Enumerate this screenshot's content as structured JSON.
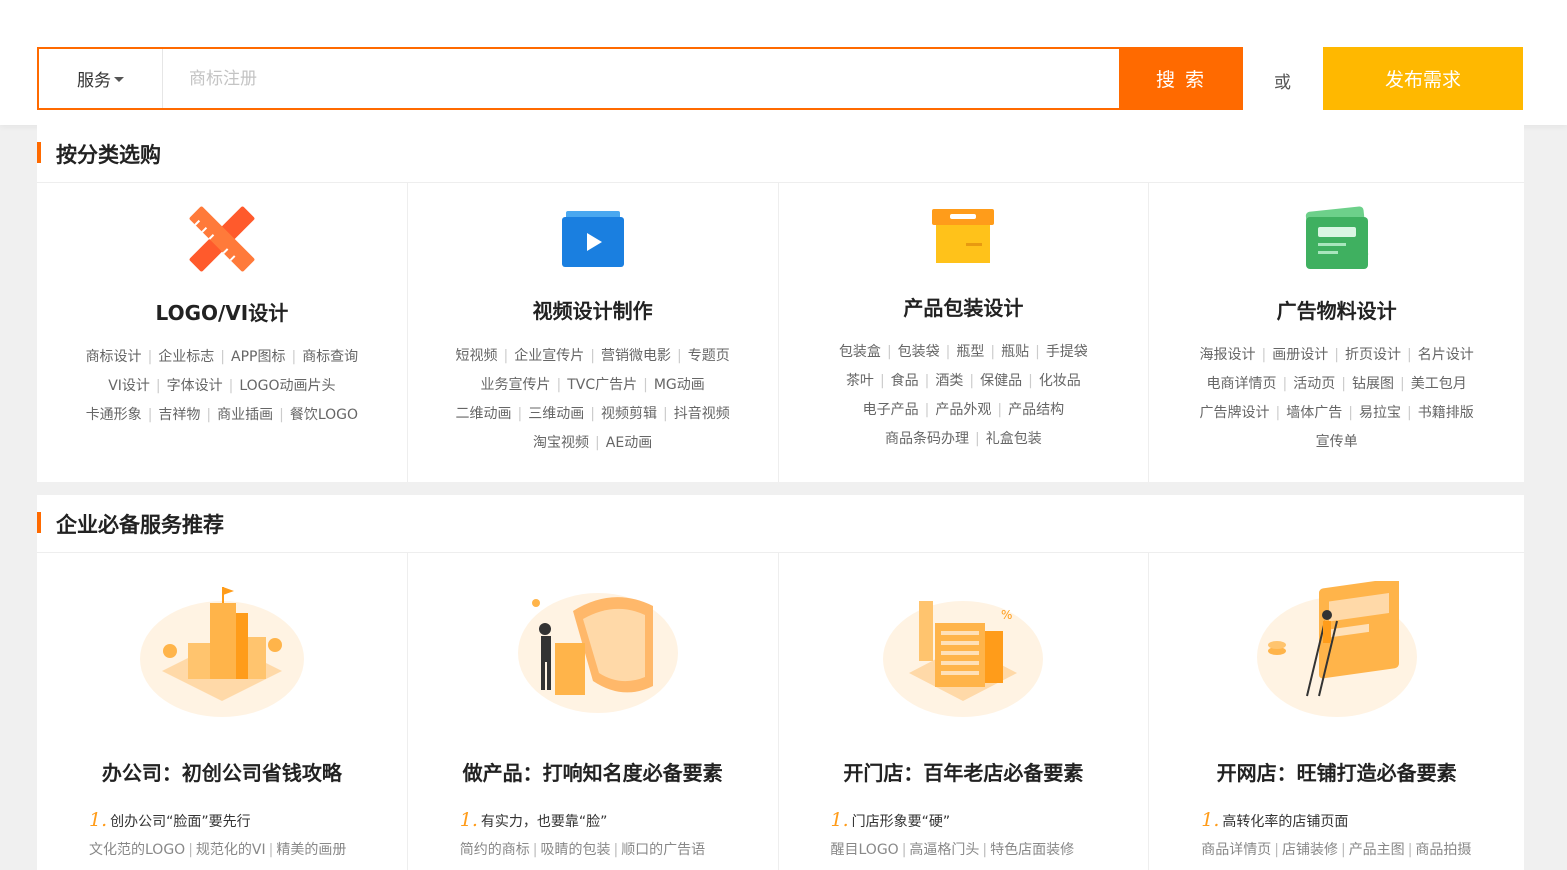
{
  "search": {
    "service_label": "服务",
    "placeholder": "商标注册",
    "button_label": "搜 索",
    "or_label": "或",
    "publish_label": "发布需求"
  },
  "colors": {
    "accent": "#ff6a00",
    "publish": "#ffb800"
  },
  "categories": {
    "title": "按分类选购",
    "items": [
      {
        "icon": "pencil-ruler-icon",
        "title": "LOGO/VI设计",
        "tags": [
          [
            "商标设计",
            "企业标志",
            "APP图标",
            "商标查询"
          ],
          [
            "VI设计",
            "字体设计",
            "LOGO动画片头"
          ],
          [
            "卡通形象",
            "吉祥物",
            "商业插画",
            "餐饮LOGO"
          ]
        ]
      },
      {
        "icon": "video-play-icon",
        "title": "视频设计制作",
        "tags": [
          [
            "短视频",
            "企业宣传片",
            "营销微电影",
            "专题页"
          ],
          [
            "业务宣传片",
            "TVC广告片",
            "MG动画"
          ],
          [
            "二维动画",
            "三维动画",
            "视频剪辑",
            "抖音视频"
          ],
          [
            "淘宝视频",
            "AE动画"
          ]
        ]
      },
      {
        "icon": "package-box-icon",
        "title": "产品包装设计",
        "tags": [
          [
            "包装盒",
            "包装袋",
            "瓶型",
            "瓶贴",
            "手提袋"
          ],
          [
            "茶叶",
            "食品",
            "酒类",
            "保健品",
            "化妆品"
          ],
          [
            "电子产品",
            "产品外观",
            "产品结构"
          ],
          [
            "商品条码办理",
            "礼盒包装"
          ]
        ]
      },
      {
        "icon": "ad-card-icon",
        "title": "广告物料设计",
        "tags": [
          [
            "海报设计",
            "画册设计",
            "折页设计",
            "名片设计"
          ],
          [
            "电商详情页",
            "活动页",
            "钻展图",
            "美工包月"
          ],
          [
            "广告牌设计",
            "墙体广告",
            "易拉宝",
            "书籍排版"
          ],
          [
            "宣传单"
          ]
        ]
      }
    ]
  },
  "recommend": {
    "title": "企业必备服务推荐",
    "items": [
      {
        "illus": "office-building-illustration",
        "title": "办公司：初创公司省钱攻略",
        "num": "1.",
        "point": "创办公司“脸面”要先行",
        "subs": [
          "文化范的LOGO",
          "规范化的VI",
          "精美的画册"
        ]
      },
      {
        "illus": "product-showcase-illustration",
        "title": "做产品：打响知名度必备要素",
        "num": "1.",
        "point": "有实力，也要靠“脸”",
        "subs": [
          "简约的商标",
          "吸睛的包装",
          "顺口的广告语"
        ]
      },
      {
        "illus": "storefront-illustration",
        "title": "开门店：百年老店必备要素",
        "num": "1.",
        "point": "门店形象要“硬”",
        "subs": [
          "醒目LOGO",
          "高逼格门头",
          "特色店面装修"
        ]
      },
      {
        "illus": "online-shop-illustration",
        "title": "开网店：旺铺打造必备要素",
        "num": "1.",
        "point": "高转化率的店铺页面",
        "subs": [
          "商品详情页",
          "店铺装修",
          "产品主图",
          "商品拍摄"
        ]
      }
    ]
  }
}
